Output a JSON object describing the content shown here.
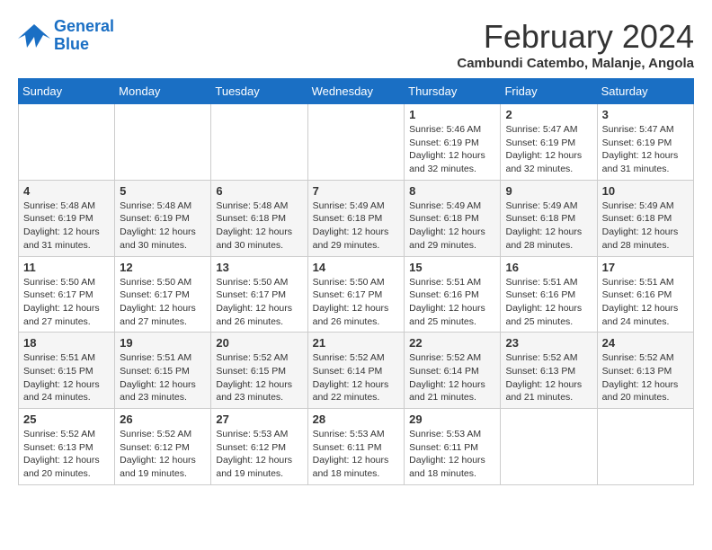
{
  "header": {
    "logo_line1": "General",
    "logo_line2": "Blue",
    "month_title": "February 2024",
    "location": "Cambundi Catembo, Malanje, Angola"
  },
  "days_of_week": [
    "Sunday",
    "Monday",
    "Tuesday",
    "Wednesday",
    "Thursday",
    "Friday",
    "Saturday"
  ],
  "weeks": [
    [
      {
        "day": "",
        "detail": ""
      },
      {
        "day": "",
        "detail": ""
      },
      {
        "day": "",
        "detail": ""
      },
      {
        "day": "",
        "detail": ""
      },
      {
        "day": "1",
        "detail": "Sunrise: 5:46 AM\nSunset: 6:19 PM\nDaylight: 12 hours\nand 32 minutes."
      },
      {
        "day": "2",
        "detail": "Sunrise: 5:47 AM\nSunset: 6:19 PM\nDaylight: 12 hours\nand 32 minutes."
      },
      {
        "day": "3",
        "detail": "Sunrise: 5:47 AM\nSunset: 6:19 PM\nDaylight: 12 hours\nand 31 minutes."
      }
    ],
    [
      {
        "day": "4",
        "detail": "Sunrise: 5:48 AM\nSunset: 6:19 PM\nDaylight: 12 hours\nand 31 minutes."
      },
      {
        "day": "5",
        "detail": "Sunrise: 5:48 AM\nSunset: 6:19 PM\nDaylight: 12 hours\nand 30 minutes."
      },
      {
        "day": "6",
        "detail": "Sunrise: 5:48 AM\nSunset: 6:18 PM\nDaylight: 12 hours\nand 30 minutes."
      },
      {
        "day": "7",
        "detail": "Sunrise: 5:49 AM\nSunset: 6:18 PM\nDaylight: 12 hours\nand 29 minutes."
      },
      {
        "day": "8",
        "detail": "Sunrise: 5:49 AM\nSunset: 6:18 PM\nDaylight: 12 hours\nand 29 minutes."
      },
      {
        "day": "9",
        "detail": "Sunrise: 5:49 AM\nSunset: 6:18 PM\nDaylight: 12 hours\nand 28 minutes."
      },
      {
        "day": "10",
        "detail": "Sunrise: 5:49 AM\nSunset: 6:18 PM\nDaylight: 12 hours\nand 28 minutes."
      }
    ],
    [
      {
        "day": "11",
        "detail": "Sunrise: 5:50 AM\nSunset: 6:17 PM\nDaylight: 12 hours\nand 27 minutes."
      },
      {
        "day": "12",
        "detail": "Sunrise: 5:50 AM\nSunset: 6:17 PM\nDaylight: 12 hours\nand 27 minutes."
      },
      {
        "day": "13",
        "detail": "Sunrise: 5:50 AM\nSunset: 6:17 PM\nDaylight: 12 hours\nand 26 minutes."
      },
      {
        "day": "14",
        "detail": "Sunrise: 5:50 AM\nSunset: 6:17 PM\nDaylight: 12 hours\nand 26 minutes."
      },
      {
        "day": "15",
        "detail": "Sunrise: 5:51 AM\nSunset: 6:16 PM\nDaylight: 12 hours\nand 25 minutes."
      },
      {
        "day": "16",
        "detail": "Sunrise: 5:51 AM\nSunset: 6:16 PM\nDaylight: 12 hours\nand 25 minutes."
      },
      {
        "day": "17",
        "detail": "Sunrise: 5:51 AM\nSunset: 6:16 PM\nDaylight: 12 hours\nand 24 minutes."
      }
    ],
    [
      {
        "day": "18",
        "detail": "Sunrise: 5:51 AM\nSunset: 6:15 PM\nDaylight: 12 hours\nand 24 minutes."
      },
      {
        "day": "19",
        "detail": "Sunrise: 5:51 AM\nSunset: 6:15 PM\nDaylight: 12 hours\nand 23 minutes."
      },
      {
        "day": "20",
        "detail": "Sunrise: 5:52 AM\nSunset: 6:15 PM\nDaylight: 12 hours\nand 23 minutes."
      },
      {
        "day": "21",
        "detail": "Sunrise: 5:52 AM\nSunset: 6:14 PM\nDaylight: 12 hours\nand 22 minutes."
      },
      {
        "day": "22",
        "detail": "Sunrise: 5:52 AM\nSunset: 6:14 PM\nDaylight: 12 hours\nand 21 minutes."
      },
      {
        "day": "23",
        "detail": "Sunrise: 5:52 AM\nSunset: 6:13 PM\nDaylight: 12 hours\nand 21 minutes."
      },
      {
        "day": "24",
        "detail": "Sunrise: 5:52 AM\nSunset: 6:13 PM\nDaylight: 12 hours\nand 20 minutes."
      }
    ],
    [
      {
        "day": "25",
        "detail": "Sunrise: 5:52 AM\nSunset: 6:13 PM\nDaylight: 12 hours\nand 20 minutes."
      },
      {
        "day": "26",
        "detail": "Sunrise: 5:52 AM\nSunset: 6:12 PM\nDaylight: 12 hours\nand 19 minutes."
      },
      {
        "day": "27",
        "detail": "Sunrise: 5:53 AM\nSunset: 6:12 PM\nDaylight: 12 hours\nand 19 minutes."
      },
      {
        "day": "28",
        "detail": "Sunrise: 5:53 AM\nSunset: 6:11 PM\nDaylight: 12 hours\nand 18 minutes."
      },
      {
        "day": "29",
        "detail": "Sunrise: 5:53 AM\nSunset: 6:11 PM\nDaylight: 12 hours\nand 18 minutes."
      },
      {
        "day": "",
        "detail": ""
      },
      {
        "day": "",
        "detail": ""
      }
    ]
  ]
}
